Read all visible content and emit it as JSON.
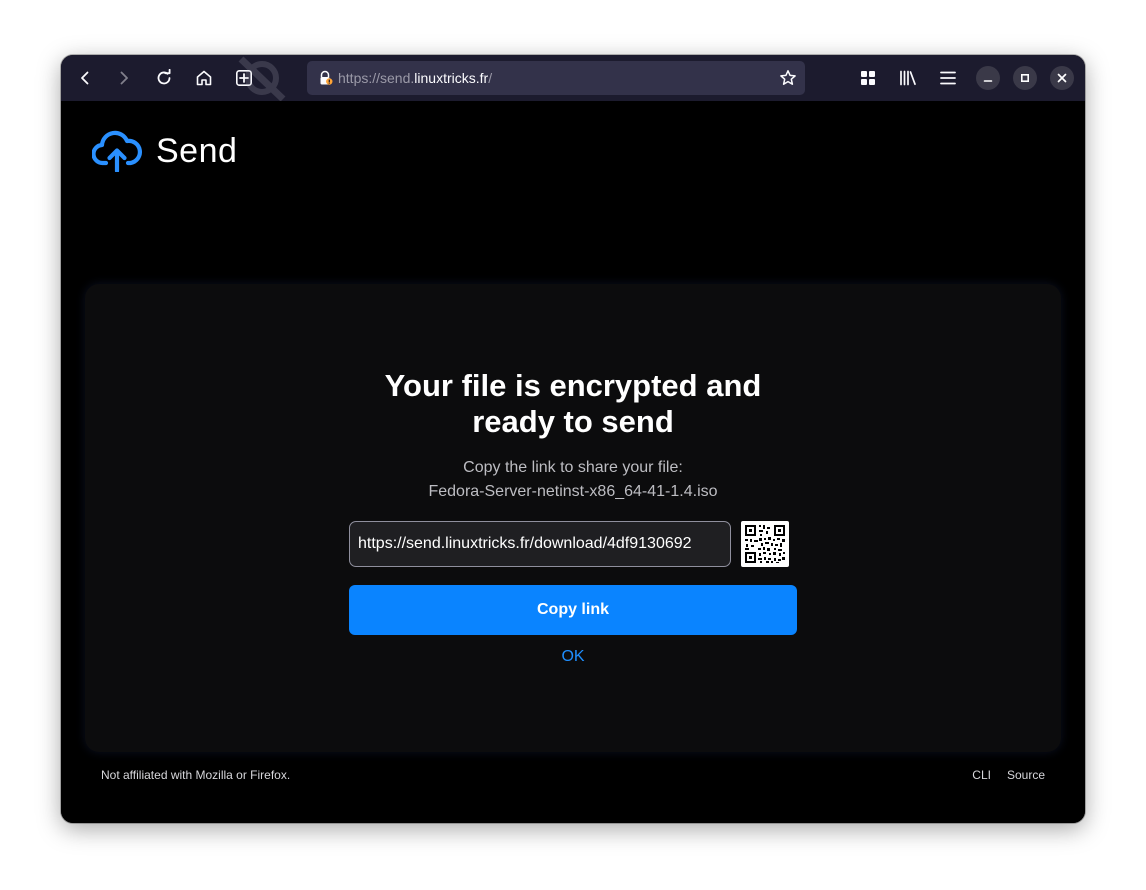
{
  "browser": {
    "url_prefix": "https://send.",
    "url_host": "linuxtricks.fr",
    "url_suffix": "/"
  },
  "app": {
    "logo_text": "Send",
    "brand_color": "#0a84ff"
  },
  "card": {
    "title_line1": "Your file is encrypted and",
    "title_line2": "ready to send",
    "subtitle_line1": "Copy the link to share your file:",
    "filename": "Fedora-Server-netinst-x86_64-41-1.4.iso",
    "share_link": "https://send.linuxtricks.fr/download/4df9130692",
    "copy_button": "Copy link",
    "ok_link": "OK"
  },
  "footer": {
    "note": "Not affiliated with Mozilla or Firefox.",
    "links": [
      "CLI",
      "Source"
    ]
  },
  "icons": [
    "back-icon",
    "forward-icon",
    "reload-icon",
    "home-icon",
    "new-tab-icon",
    "lock-icon",
    "star-icon",
    "extensions-icon",
    "library-icon",
    "menu-icon",
    "minimize-icon",
    "maximize-icon",
    "close-icon",
    "qr-code-icon",
    "cloud-upload-icon"
  ]
}
